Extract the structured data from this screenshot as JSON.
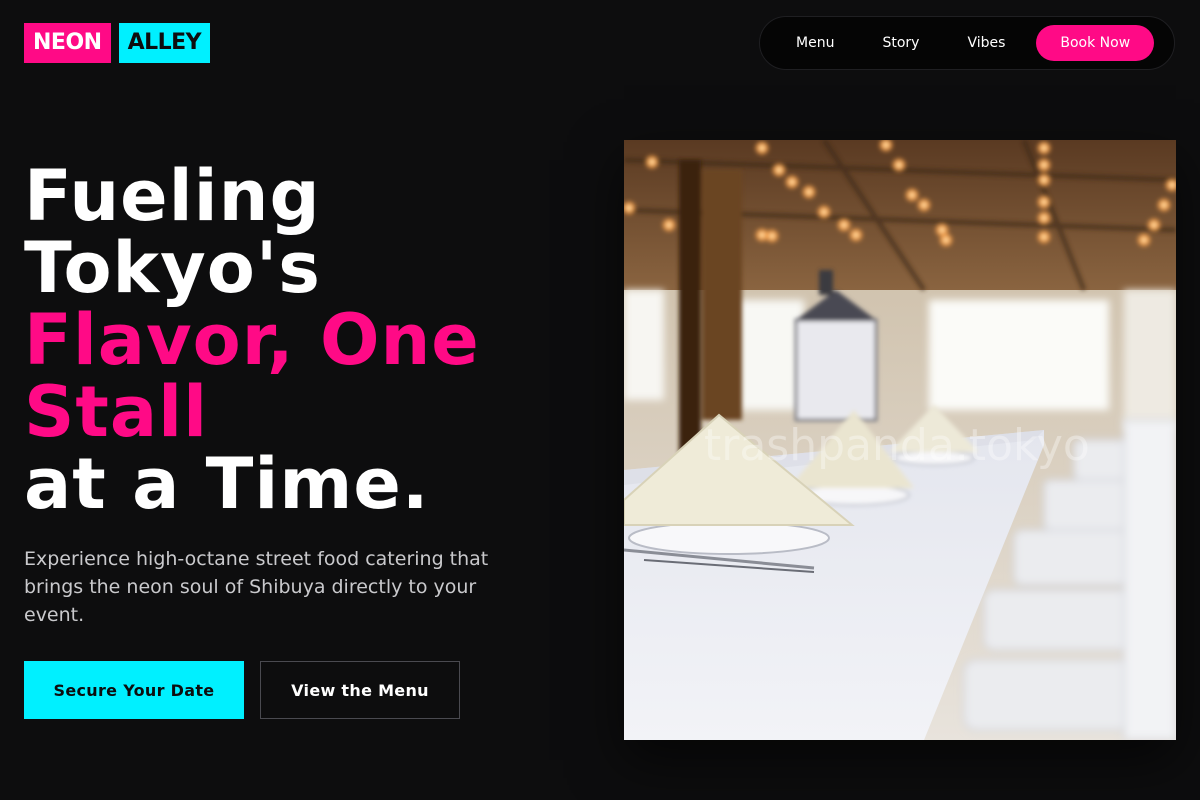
{
  "brand": {
    "part1": "NEON",
    "part2": "ALLEY"
  },
  "nav": {
    "items": [
      {
        "label": "Menu"
      },
      {
        "label": "Story"
      },
      {
        "label": "Vibes"
      }
    ],
    "cta_label": "Book Now"
  },
  "hero": {
    "title_lines": [
      "Fueling",
      "Tokyo's"
    ],
    "title_highlight_lines": [
      "Flavor, One",
      "Stall"
    ],
    "title_end": "at a Time.",
    "subtitle": "Experience high-octane street food catering that brings the neon soul of Shibuya directly to your event.",
    "primary_cta": "Secure Your Date",
    "secondary_cta": "View the Menu",
    "image_watermark": "trashpanda.tokyo"
  },
  "colors": {
    "background": "#0d0d0e",
    "accent_pink": "#ff0a86",
    "accent_cyan": "#00f0ff"
  }
}
